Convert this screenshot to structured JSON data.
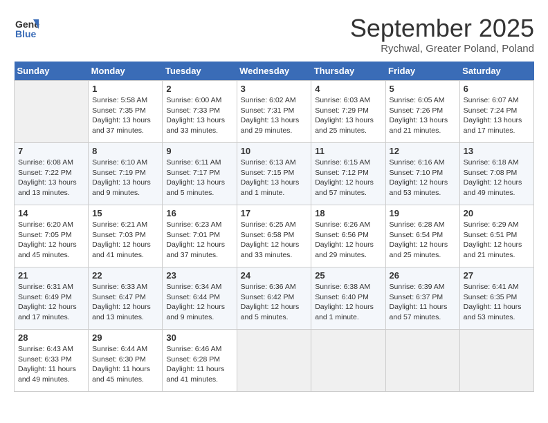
{
  "logo": {
    "line1": "General",
    "line2": "Blue"
  },
  "title": "September 2025",
  "subtitle": "Rychwal, Greater Poland, Poland",
  "weekdays": [
    "Sunday",
    "Monday",
    "Tuesday",
    "Wednesday",
    "Thursday",
    "Friday",
    "Saturday"
  ],
  "weeks": [
    [
      {
        "day": "",
        "info": ""
      },
      {
        "day": "1",
        "info": "Sunrise: 5:58 AM\nSunset: 7:35 PM\nDaylight: 13 hours\nand 37 minutes."
      },
      {
        "day": "2",
        "info": "Sunrise: 6:00 AM\nSunset: 7:33 PM\nDaylight: 13 hours\nand 33 minutes."
      },
      {
        "day": "3",
        "info": "Sunrise: 6:02 AM\nSunset: 7:31 PM\nDaylight: 13 hours\nand 29 minutes."
      },
      {
        "day": "4",
        "info": "Sunrise: 6:03 AM\nSunset: 7:29 PM\nDaylight: 13 hours\nand 25 minutes."
      },
      {
        "day": "5",
        "info": "Sunrise: 6:05 AM\nSunset: 7:26 PM\nDaylight: 13 hours\nand 21 minutes."
      },
      {
        "day": "6",
        "info": "Sunrise: 6:07 AM\nSunset: 7:24 PM\nDaylight: 13 hours\nand 17 minutes."
      }
    ],
    [
      {
        "day": "7",
        "info": "Sunrise: 6:08 AM\nSunset: 7:22 PM\nDaylight: 13 hours\nand 13 minutes."
      },
      {
        "day": "8",
        "info": "Sunrise: 6:10 AM\nSunset: 7:19 PM\nDaylight: 13 hours\nand 9 minutes."
      },
      {
        "day": "9",
        "info": "Sunrise: 6:11 AM\nSunset: 7:17 PM\nDaylight: 13 hours\nand 5 minutes."
      },
      {
        "day": "10",
        "info": "Sunrise: 6:13 AM\nSunset: 7:15 PM\nDaylight: 13 hours\nand 1 minute."
      },
      {
        "day": "11",
        "info": "Sunrise: 6:15 AM\nSunset: 7:12 PM\nDaylight: 12 hours\nand 57 minutes."
      },
      {
        "day": "12",
        "info": "Sunrise: 6:16 AM\nSunset: 7:10 PM\nDaylight: 12 hours\nand 53 minutes."
      },
      {
        "day": "13",
        "info": "Sunrise: 6:18 AM\nSunset: 7:08 PM\nDaylight: 12 hours\nand 49 minutes."
      }
    ],
    [
      {
        "day": "14",
        "info": "Sunrise: 6:20 AM\nSunset: 7:05 PM\nDaylight: 12 hours\nand 45 minutes."
      },
      {
        "day": "15",
        "info": "Sunrise: 6:21 AM\nSunset: 7:03 PM\nDaylight: 12 hours\nand 41 minutes."
      },
      {
        "day": "16",
        "info": "Sunrise: 6:23 AM\nSunset: 7:01 PM\nDaylight: 12 hours\nand 37 minutes."
      },
      {
        "day": "17",
        "info": "Sunrise: 6:25 AM\nSunset: 6:58 PM\nDaylight: 12 hours\nand 33 minutes."
      },
      {
        "day": "18",
        "info": "Sunrise: 6:26 AM\nSunset: 6:56 PM\nDaylight: 12 hours\nand 29 minutes."
      },
      {
        "day": "19",
        "info": "Sunrise: 6:28 AM\nSunset: 6:54 PM\nDaylight: 12 hours\nand 25 minutes."
      },
      {
        "day": "20",
        "info": "Sunrise: 6:29 AM\nSunset: 6:51 PM\nDaylight: 12 hours\nand 21 minutes."
      }
    ],
    [
      {
        "day": "21",
        "info": "Sunrise: 6:31 AM\nSunset: 6:49 PM\nDaylight: 12 hours\nand 17 minutes."
      },
      {
        "day": "22",
        "info": "Sunrise: 6:33 AM\nSunset: 6:47 PM\nDaylight: 12 hours\nand 13 minutes."
      },
      {
        "day": "23",
        "info": "Sunrise: 6:34 AM\nSunset: 6:44 PM\nDaylight: 12 hours\nand 9 minutes."
      },
      {
        "day": "24",
        "info": "Sunrise: 6:36 AM\nSunset: 6:42 PM\nDaylight: 12 hours\nand 5 minutes."
      },
      {
        "day": "25",
        "info": "Sunrise: 6:38 AM\nSunset: 6:40 PM\nDaylight: 12 hours\nand 1 minute."
      },
      {
        "day": "26",
        "info": "Sunrise: 6:39 AM\nSunset: 6:37 PM\nDaylight: 11 hours\nand 57 minutes."
      },
      {
        "day": "27",
        "info": "Sunrise: 6:41 AM\nSunset: 6:35 PM\nDaylight: 11 hours\nand 53 minutes."
      }
    ],
    [
      {
        "day": "28",
        "info": "Sunrise: 6:43 AM\nSunset: 6:33 PM\nDaylight: 11 hours\nand 49 minutes."
      },
      {
        "day": "29",
        "info": "Sunrise: 6:44 AM\nSunset: 6:30 PM\nDaylight: 11 hours\nand 45 minutes."
      },
      {
        "day": "30",
        "info": "Sunrise: 6:46 AM\nSunset: 6:28 PM\nDaylight: 11 hours\nand 41 minutes."
      },
      {
        "day": "",
        "info": ""
      },
      {
        "day": "",
        "info": ""
      },
      {
        "day": "",
        "info": ""
      },
      {
        "day": "",
        "info": ""
      }
    ]
  ]
}
